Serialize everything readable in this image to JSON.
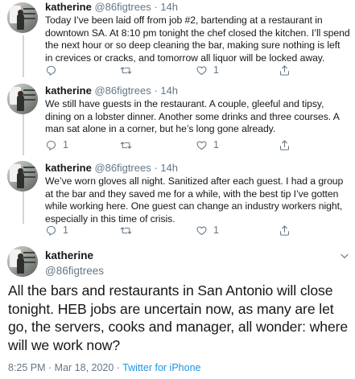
{
  "tweets": [
    {
      "name": "katherine",
      "handle": "@86figtrees",
      "dot": "·",
      "time": "14h",
      "text": "Today I’ve been laid off from job #2, bartending at a restaurant in downtown SA. At 8:10 pm tonight the chef closed the kitchen. I’ll spend the next hour or so deep cleaning the bar, making sure nothing is left in crevices or cracks, and tomorrow all liquor will be locked away.",
      "reply_count": "",
      "retweet_count": "",
      "like_count": "1"
    },
    {
      "name": "katherine",
      "handle": "@86figtrees",
      "dot": "·",
      "time": "14h",
      "text": "We still have guests in the restaurant. A couple, gleeful and tipsy, dining on a lobster dinner. Another some drinks and three courses. A man sat alone in a corner, but he’s long gone already.",
      "reply_count": "1",
      "retweet_count": "",
      "like_count": "1"
    },
    {
      "name": "katherine",
      "handle": "@86figtrees",
      "dot": "·",
      "time": "14h",
      "text": "We’ve worn gloves all night. Sanitized after each guest. I had a group at the bar and they saved me for a while, with the best tip I’ve gotten while working here. One guest can change an industry workers night, especially in this time of crisis.",
      "reply_count": "1",
      "retweet_count": "",
      "like_count": "1"
    }
  ],
  "main": {
    "name": "katherine",
    "handle": "@86figtrees",
    "text": "All the bars and restaurants in San Antonio will close tonight. HEB jobs are uncertain now, as many are let go, the servers, cooks and manager, all wonder: where will we work now?",
    "timestamp": "8:25 PM · Mar 18, 2020 · ",
    "source": "Twitter for iPhone"
  },
  "icons": {
    "reply": "reply-icon",
    "retweet": "retweet-icon",
    "like": "heart-icon",
    "share": "share-icon",
    "caret": "chevron-down-icon"
  },
  "colors": {
    "text": "#14171a",
    "secondary": "#657786",
    "link": "#1b95e0",
    "divider": "#e6ecf0",
    "thread_line": "#ccd6dd"
  }
}
